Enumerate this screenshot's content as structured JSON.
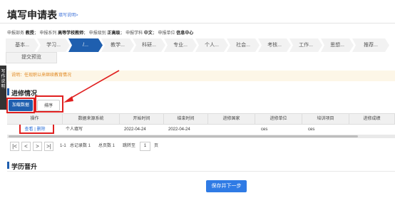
{
  "header": {
    "title": "填写申请表",
    "help_link": "填写说明>"
  },
  "meta": {
    "dept_label": "申报部务",
    "dept_value": "教授",
    "series_label": "申报系列",
    "series_value": "高等学校教师",
    "level_label": "申报级别",
    "level_value": "正高级",
    "subject_label": "申报学科",
    "subject_value": "中文",
    "unit_label": "申报单位",
    "unit_value": "信息中心"
  },
  "steps": [
    "基本...",
    "学习...",
    "/...",
    "教学...",
    "科研...",
    "专业...",
    "个人...",
    "社会...",
    "考核...",
    "工作...",
    "思想...",
    "推荐..."
  ],
  "active_step_index": 2,
  "submit_tab": "提交预览",
  "sidebar": {
    "text": "写作说明"
  },
  "notice": "说明：任现职以来继续教育情况",
  "section1": {
    "title": "进修情况",
    "load_button": "加载数据",
    "sort_button": "排序"
  },
  "table": {
    "headers": [
      "操作",
      "数据来源系统",
      "开始时间",
      "结束时间",
      "进修国家",
      "进修单位",
      "培训项目",
      "进修成绩"
    ],
    "rows": [
      {
        "view": "查看",
        "sep": "|",
        "delete": "删除",
        "source": "个人填写",
        "start": "2022-04-24",
        "end": "2022-04-24",
        "country": "",
        "unit": "ces",
        "project": "ces",
        "score": ""
      }
    ]
  },
  "pager": {
    "first": "|<",
    "prev": "<",
    "next": ">",
    "last": ">|",
    "range": "1-1",
    "total_records": "总记录数 1",
    "total_pages": "总页数 1",
    "goto_label": "跳转至",
    "page_value": "1",
    "page_unit": "页"
  },
  "section2": {
    "title": "学历晋升"
  },
  "footer": {
    "save_button": "保存并下一步"
  },
  "colors": {
    "primary": "#1f5faf",
    "save": "#2f7be5",
    "notice_text": "#e0871f",
    "notice_bg": "#fdf6e7",
    "annotation_red": "#e02020",
    "link": "#2b6fd8"
  }
}
